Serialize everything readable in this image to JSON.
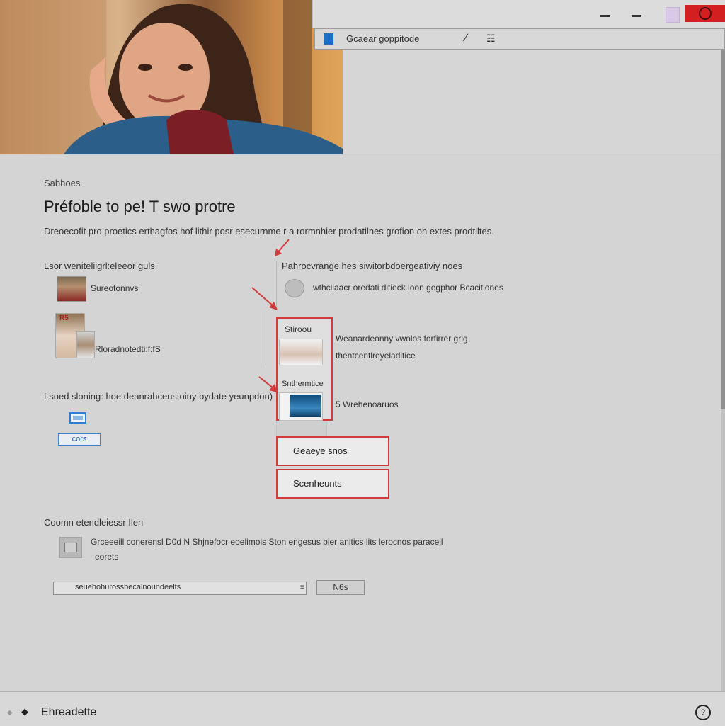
{
  "window": {
    "address_text": "Gcaear goppitode",
    "close_color": "#d31f1f"
  },
  "page": {
    "breadcrumb": "Sabhoes",
    "title": "Préfoble to pe! T swo protre",
    "description": "Dreoecofit pro proetics erthagfos hof lithir posr esecurnme r a rormnhier prodatilnes grofion on extes prodtiltes."
  },
  "left_column": {
    "section1_label": "Lsor weniteliigrl:eleeor guls",
    "item1_label": "Sureotonnvs",
    "item2_badge": "R5",
    "item2_label": "Rloradnotedti:f:fS",
    "section2_label": "Lsoed sloning: hoe deanrahceustoiny bydate yeunpdon)",
    "button_label": "cors"
  },
  "right_column": {
    "section_label": "Pahrocvrange hes siwitorbdoergeativiy noes",
    "row1_text": "wthcliaacr oredati ditieck loon gegphor Bcacitiones",
    "box_label1": "Stiroou",
    "box_text1": "Weanardeonny vwolos forfirrer grlg",
    "box_text2": "thentcentlreyeladitice",
    "box_label2": "Snthermtice",
    "box_text3": "5 Wrehenoaruos",
    "button1": "Geaeye snos",
    "button2": "Scenheunts"
  },
  "bottom_section": {
    "label": "Coomn etendleiessr Ilen",
    "desc_line1": "Grceeeill conerensl D0d N Shjnefocr eoelimols Ston engesus bier anitics lits lerocnos paracell",
    "desc_line2": "eorets",
    "input_value": "seuehohurossbecalnoundeelts",
    "button_label": "N6s"
  },
  "statusbar": {
    "text": "Ehreadette",
    "help_glyph": "?"
  },
  "colors": {
    "accent_red": "#d23b3b",
    "accent_blue": "#2e7ed6"
  }
}
